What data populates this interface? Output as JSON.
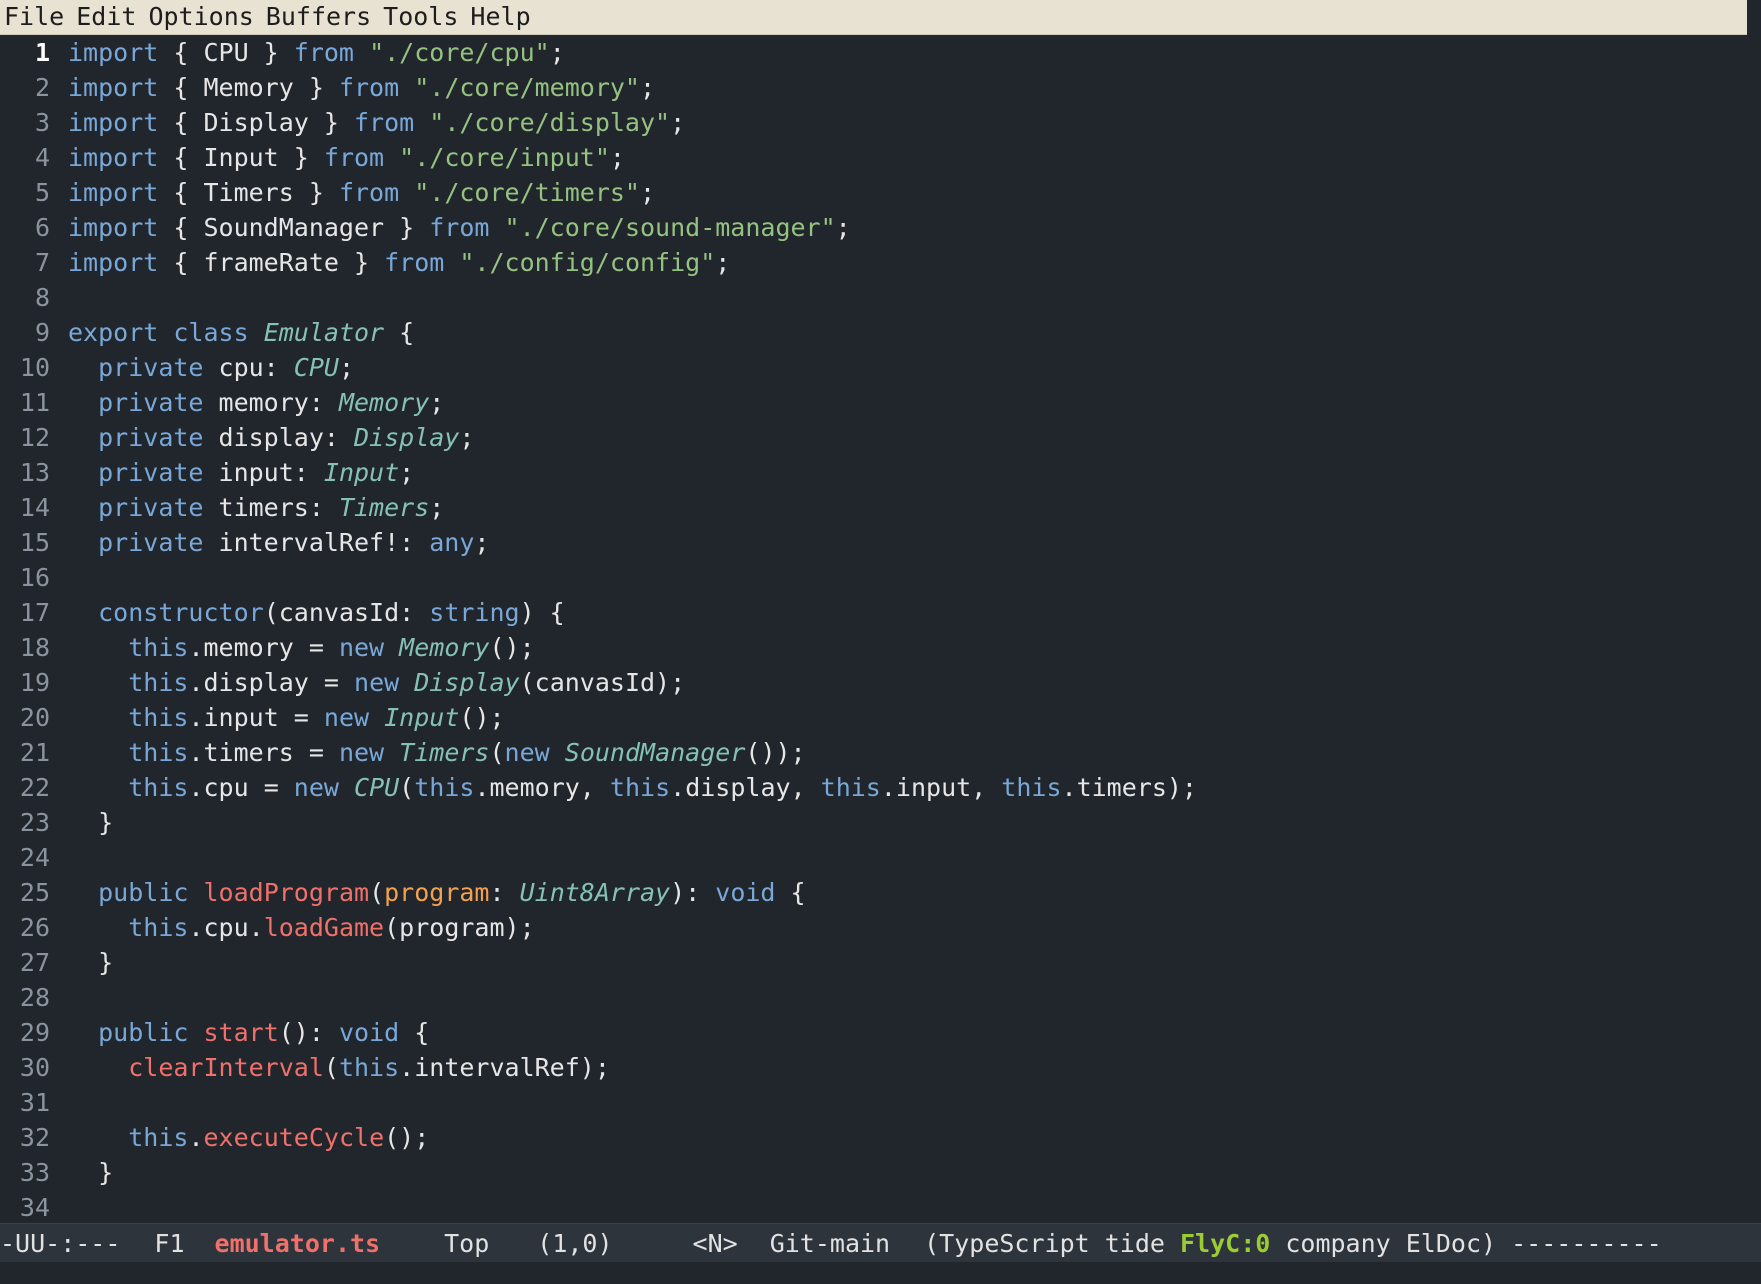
{
  "menu": [
    "File",
    "Edit",
    "Options",
    "Buffers",
    "Tools",
    "Help"
  ],
  "editor": {
    "current_line": 1,
    "lines": [
      [
        [
          "kw",
          "import"
        ],
        [
          "id",
          " { CPU } "
        ],
        [
          "kw",
          "from"
        ],
        [
          "id",
          " "
        ],
        [
          "str",
          "\"./core/cpu\""
        ],
        [
          "id",
          ";"
        ]
      ],
      [
        [
          "kw",
          "import"
        ],
        [
          "id",
          " { Memory } "
        ],
        [
          "kw",
          "from"
        ],
        [
          "id",
          " "
        ],
        [
          "str",
          "\"./core/memory\""
        ],
        [
          "id",
          ";"
        ]
      ],
      [
        [
          "kw",
          "import"
        ],
        [
          "id",
          " { Display } "
        ],
        [
          "kw",
          "from"
        ],
        [
          "id",
          " "
        ],
        [
          "str",
          "\"./core/display\""
        ],
        [
          "id",
          ";"
        ]
      ],
      [
        [
          "kw",
          "import"
        ],
        [
          "id",
          " { Input } "
        ],
        [
          "kw",
          "from"
        ],
        [
          "id",
          " "
        ],
        [
          "str",
          "\"./core/input\""
        ],
        [
          "id",
          ";"
        ]
      ],
      [
        [
          "kw",
          "import"
        ],
        [
          "id",
          " { Timers } "
        ],
        [
          "kw",
          "from"
        ],
        [
          "id",
          " "
        ],
        [
          "str",
          "\"./core/timers\""
        ],
        [
          "id",
          ";"
        ]
      ],
      [
        [
          "kw",
          "import"
        ],
        [
          "id",
          " { SoundManager } "
        ],
        [
          "kw",
          "from"
        ],
        [
          "id",
          " "
        ],
        [
          "str",
          "\"./core/sound-manager\""
        ],
        [
          "id",
          ";"
        ]
      ],
      [
        [
          "kw",
          "import"
        ],
        [
          "id",
          " { frameRate } "
        ],
        [
          "kw",
          "from"
        ],
        [
          "id",
          " "
        ],
        [
          "str",
          "\"./config/config\""
        ],
        [
          "id",
          ";"
        ]
      ],
      [],
      [
        [
          "kw",
          "export"
        ],
        [
          "id",
          " "
        ],
        [
          "kw",
          "class"
        ],
        [
          "id",
          " "
        ],
        [
          "type",
          "Emulator"
        ],
        [
          "id",
          " {"
        ]
      ],
      [
        [
          "id",
          "  "
        ],
        [
          "kw",
          "private"
        ],
        [
          "id",
          " cpu: "
        ],
        [
          "type",
          "CPU"
        ],
        [
          "id",
          ";"
        ]
      ],
      [
        [
          "id",
          "  "
        ],
        [
          "kw",
          "private"
        ],
        [
          "id",
          " memory: "
        ],
        [
          "type",
          "Memory"
        ],
        [
          "id",
          ";"
        ]
      ],
      [
        [
          "id",
          "  "
        ],
        [
          "kw",
          "private"
        ],
        [
          "id",
          " display: "
        ],
        [
          "type",
          "Display"
        ],
        [
          "id",
          ";"
        ]
      ],
      [
        [
          "id",
          "  "
        ],
        [
          "kw",
          "private"
        ],
        [
          "id",
          " input: "
        ],
        [
          "type",
          "Input"
        ],
        [
          "id",
          ";"
        ]
      ],
      [
        [
          "id",
          "  "
        ],
        [
          "kw",
          "private"
        ],
        [
          "id",
          " timers: "
        ],
        [
          "type",
          "Timers"
        ],
        [
          "id",
          ";"
        ]
      ],
      [
        [
          "id",
          "  "
        ],
        [
          "kw",
          "private"
        ],
        [
          "id",
          " intervalRef!: "
        ],
        [
          "kw",
          "any"
        ],
        [
          "id",
          ";"
        ]
      ],
      [],
      [
        [
          "id",
          "  "
        ],
        [
          "kw",
          "constructor"
        ],
        [
          "id",
          "(canvasId: "
        ],
        [
          "kw",
          "string"
        ],
        [
          "id",
          ") {"
        ]
      ],
      [
        [
          "id",
          "    "
        ],
        [
          "kw",
          "this"
        ],
        [
          "id",
          ".memory = "
        ],
        [
          "kw",
          "new"
        ],
        [
          "id",
          " "
        ],
        [
          "type",
          "Memory"
        ],
        [
          "id",
          "();"
        ]
      ],
      [
        [
          "id",
          "    "
        ],
        [
          "kw",
          "this"
        ],
        [
          "id",
          ".display = "
        ],
        [
          "kw",
          "new"
        ],
        [
          "id",
          " "
        ],
        [
          "type",
          "Display"
        ],
        [
          "id",
          "(canvasId);"
        ]
      ],
      [
        [
          "id",
          "    "
        ],
        [
          "kw",
          "this"
        ],
        [
          "id",
          ".input = "
        ],
        [
          "kw",
          "new"
        ],
        [
          "id",
          " "
        ],
        [
          "type",
          "Input"
        ],
        [
          "id",
          "();"
        ]
      ],
      [
        [
          "id",
          "    "
        ],
        [
          "kw",
          "this"
        ],
        [
          "id",
          ".timers = "
        ],
        [
          "kw",
          "new"
        ],
        [
          "id",
          " "
        ],
        [
          "type",
          "Timers"
        ],
        [
          "id",
          "("
        ],
        [
          "kw",
          "new"
        ],
        [
          "id",
          " "
        ],
        [
          "type",
          "SoundManager"
        ],
        [
          "id",
          "());"
        ]
      ],
      [
        [
          "id",
          "    "
        ],
        [
          "kw",
          "this"
        ],
        [
          "id",
          ".cpu = "
        ],
        [
          "kw",
          "new"
        ],
        [
          "id",
          " "
        ],
        [
          "type",
          "CPU"
        ],
        [
          "id",
          "("
        ],
        [
          "kw",
          "this"
        ],
        [
          "id",
          ".memory, "
        ],
        [
          "kw",
          "this"
        ],
        [
          "id",
          ".display, "
        ],
        [
          "kw",
          "this"
        ],
        [
          "id",
          ".input, "
        ],
        [
          "kw",
          "this"
        ],
        [
          "id",
          ".timers);"
        ]
      ],
      [
        [
          "id",
          "  }"
        ]
      ],
      [],
      [
        [
          "id",
          "  "
        ],
        [
          "kw",
          "public"
        ],
        [
          "id",
          " "
        ],
        [
          "fn",
          "loadProgram"
        ],
        [
          "id",
          "("
        ],
        [
          "prm",
          "program"
        ],
        [
          "id",
          ": "
        ],
        [
          "type",
          "Uint8Array"
        ],
        [
          "id",
          "): "
        ],
        [
          "kw",
          "void"
        ],
        [
          "id",
          " {"
        ]
      ],
      [
        [
          "id",
          "    "
        ],
        [
          "kw",
          "this"
        ],
        [
          "id",
          ".cpu."
        ],
        [
          "fn",
          "loadGame"
        ],
        [
          "id",
          "(program);"
        ]
      ],
      [
        [
          "id",
          "  }"
        ]
      ],
      [],
      [
        [
          "id",
          "  "
        ],
        [
          "kw",
          "public"
        ],
        [
          "id",
          " "
        ],
        [
          "fn",
          "start"
        ],
        [
          "id",
          "(): "
        ],
        [
          "kw",
          "void"
        ],
        [
          "id",
          " {"
        ]
      ],
      [
        [
          "id",
          "    "
        ],
        [
          "fn",
          "clearInterval"
        ],
        [
          "id",
          "("
        ],
        [
          "kw",
          "this"
        ],
        [
          "id",
          ".intervalRef);"
        ]
      ],
      [],
      [
        [
          "id",
          "    "
        ],
        [
          "kw",
          "this"
        ],
        [
          "id",
          "."
        ],
        [
          "fn",
          "executeCycle"
        ],
        [
          "id",
          "();"
        ]
      ],
      [
        [
          "id",
          "  }"
        ]
      ],
      []
    ]
  },
  "modeline": {
    "status": "-UU-:---",
    "frame": "F1",
    "buffer": "emulator.ts",
    "position": "Top",
    "cursor": "(1,0)",
    "evil_state": "<N>",
    "vcs": "Git-main",
    "modes_open": "(TypeScript tide ",
    "flycheck": "FlyC:0",
    "modes_close": " company ElDoc)",
    "tail": " ----------"
  },
  "colors": {
    "background": "#21262c",
    "menubar": "#e8e2d2",
    "keyword": "#79a8d8",
    "string": "#95c280",
    "type": "#86c2b4",
    "function": "#f0706a",
    "parameter": "#f2a14f",
    "line_number": "#8b949e"
  }
}
